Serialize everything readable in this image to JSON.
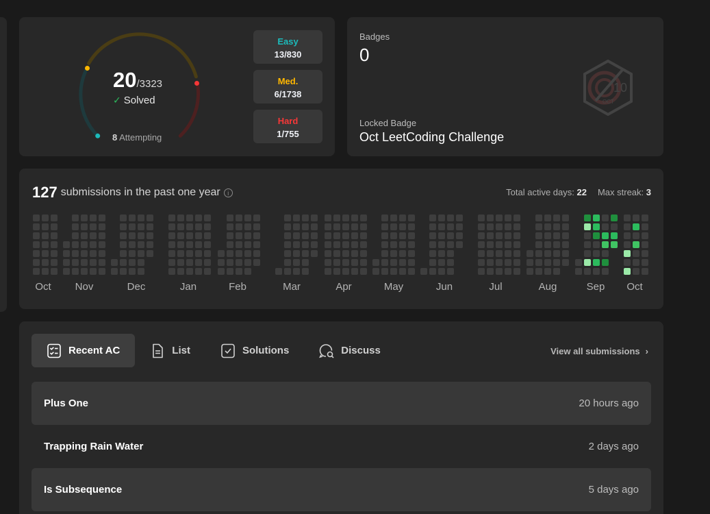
{
  "progress": {
    "solved": "20",
    "total": "/3323",
    "solved_label": "Solved",
    "attempting_count": "8",
    "attempting_label": "Attempting",
    "difficulties": [
      {
        "name": "Easy",
        "count": "13/830",
        "color": "#1cbaba"
      },
      {
        "name": "Med.",
        "count": "6/1738",
        "color": "#ffb700"
      },
      {
        "name": "Hard",
        "count": "1/755",
        "color": "#f63737"
      }
    ]
  },
  "badges": {
    "label": "Badges",
    "count": "0",
    "locked_label": "Locked Badge",
    "locked_name": "Oct LeetCoding Challenge",
    "badge_icon": "oct-challenge-badge-icon"
  },
  "calendar": {
    "count": "127",
    "title_text": "submissions in the past one year",
    "active_days_label": "Total active days:",
    "active_days": "22",
    "max_streak_label": "Max streak:",
    "max_streak": "3",
    "months": [
      "Oct",
      "Nov",
      "Dec",
      "Jan",
      "Feb",
      "Mar",
      "Apr",
      "May",
      "Jun",
      "Jul",
      "Aug",
      "Sep",
      "Oct"
    ],
    "colors": {
      "empty": "#3e3e3e",
      "level1": "#9be9a8",
      "level2": "#40c463",
      "level3": "#2cbb5d",
      "level4": "#1f8f3d"
    }
  },
  "recent": {
    "tabs": [
      {
        "label": "Recent AC",
        "icon": "checklist-icon",
        "active": true
      },
      {
        "label": "List",
        "icon": "document-icon",
        "active": false
      },
      {
        "label": "Solutions",
        "icon": "checkbox-icon",
        "active": false
      },
      {
        "label": "Discuss",
        "icon": "discuss-icon",
        "active": false
      }
    ],
    "view_all": "View all submissions",
    "rows": [
      {
        "title": "Plus One",
        "time": "20 hours ago"
      },
      {
        "title": "Trapping Rain Water",
        "time": "2 days ago"
      },
      {
        "title": "Is Subsequence",
        "time": "5 days ago"
      }
    ]
  }
}
